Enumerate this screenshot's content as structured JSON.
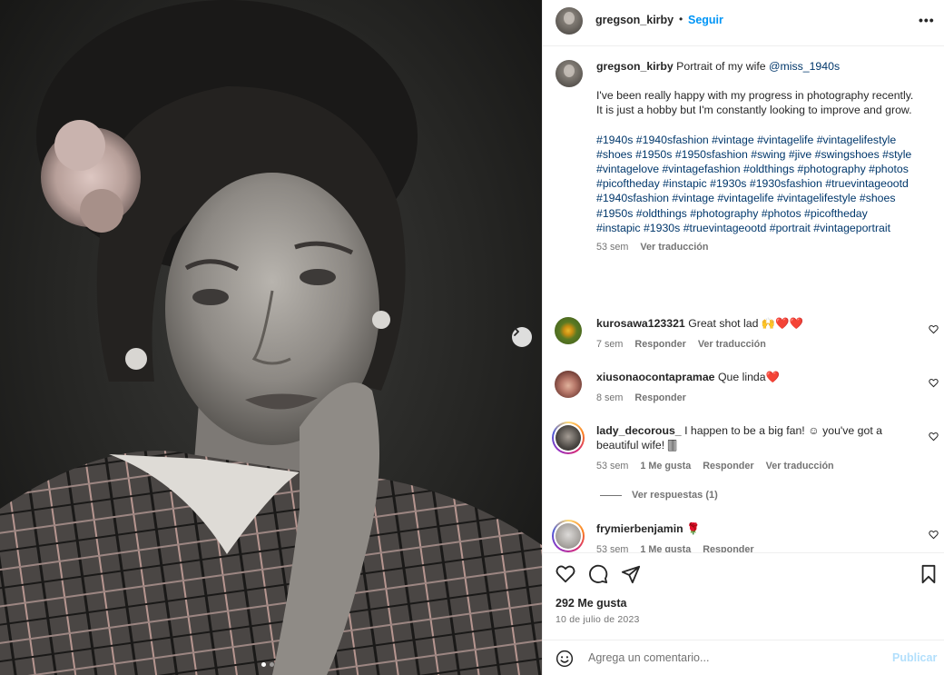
{
  "header": {
    "username": "gregson_kirby",
    "separator": "•",
    "follow_label": "Seguir",
    "more_label": "•••"
  },
  "caption": {
    "username": "gregson_kirby",
    "text_start": "Portrait of my wife",
    "mention": "@miss_1940s",
    "line1": "I've been really happy with my progress in photography recently.",
    "line2": "It is just a hobby but I'm constantly looking to improve and grow.",
    "hashtags": "#1940s #1940sfashion #vintage #vintagelife #vintagelifestyle #shoes #1950s #1950sfashion #swing #jive #swingshoes #style #vintagelove #vintagefashion #oldthings #photography #photos #picoftheday #instapic #1930s #1930sfashion #truevintageootd #1940sfashion #vintage #vintagelife #vintagelifestyle #shoes #1950s #oldthings #photography #photos #picoftheday #instapic #1930s #truevintageootd #portrait #vintageportrait",
    "time": "53 sem",
    "translate": "Ver traducción"
  },
  "comments": [
    {
      "username": "kurosawa123321",
      "text": "Great shot lad 🙌❤️❤️",
      "time": "7 sem",
      "reply": "Responder",
      "translate": "Ver traducción"
    },
    {
      "username": "xiusonaocontapramae",
      "text": "Que linda❤️",
      "time": "8 sem",
      "reply": "Responder"
    },
    {
      "username": "lady_decorous_",
      "text": "I happen to be a big fan! ☺ you've got a beautiful wife! 🀫",
      "time": "53 sem",
      "likes": "1 Me gusta",
      "reply": "Responder",
      "translate": "Ver traducción",
      "view_replies": "Ver respuestas (1)"
    },
    {
      "username": "frymierbenjamin",
      "text": "🌹",
      "time": "53 sem",
      "likes": "1 Me gusta",
      "reply": "Responder"
    }
  ],
  "footer": {
    "likes": "292 Me gusta",
    "date": "10 de julio de 2023",
    "comment_placeholder": "Agrega un comentario...",
    "publish_label": "Publicar"
  },
  "carousel": {
    "current": 1,
    "total": 2
  },
  "icons": {
    "next": "chevron-right-icon",
    "like": "heart-icon",
    "comment": "comment-icon",
    "share": "share-icon",
    "save": "bookmark-icon",
    "emoji": "emoji-icon"
  },
  "colors": {
    "accent": "#0095f6",
    "link": "#00376b",
    "muted": "#737373",
    "publish_disabled": "#b2dffc"
  }
}
